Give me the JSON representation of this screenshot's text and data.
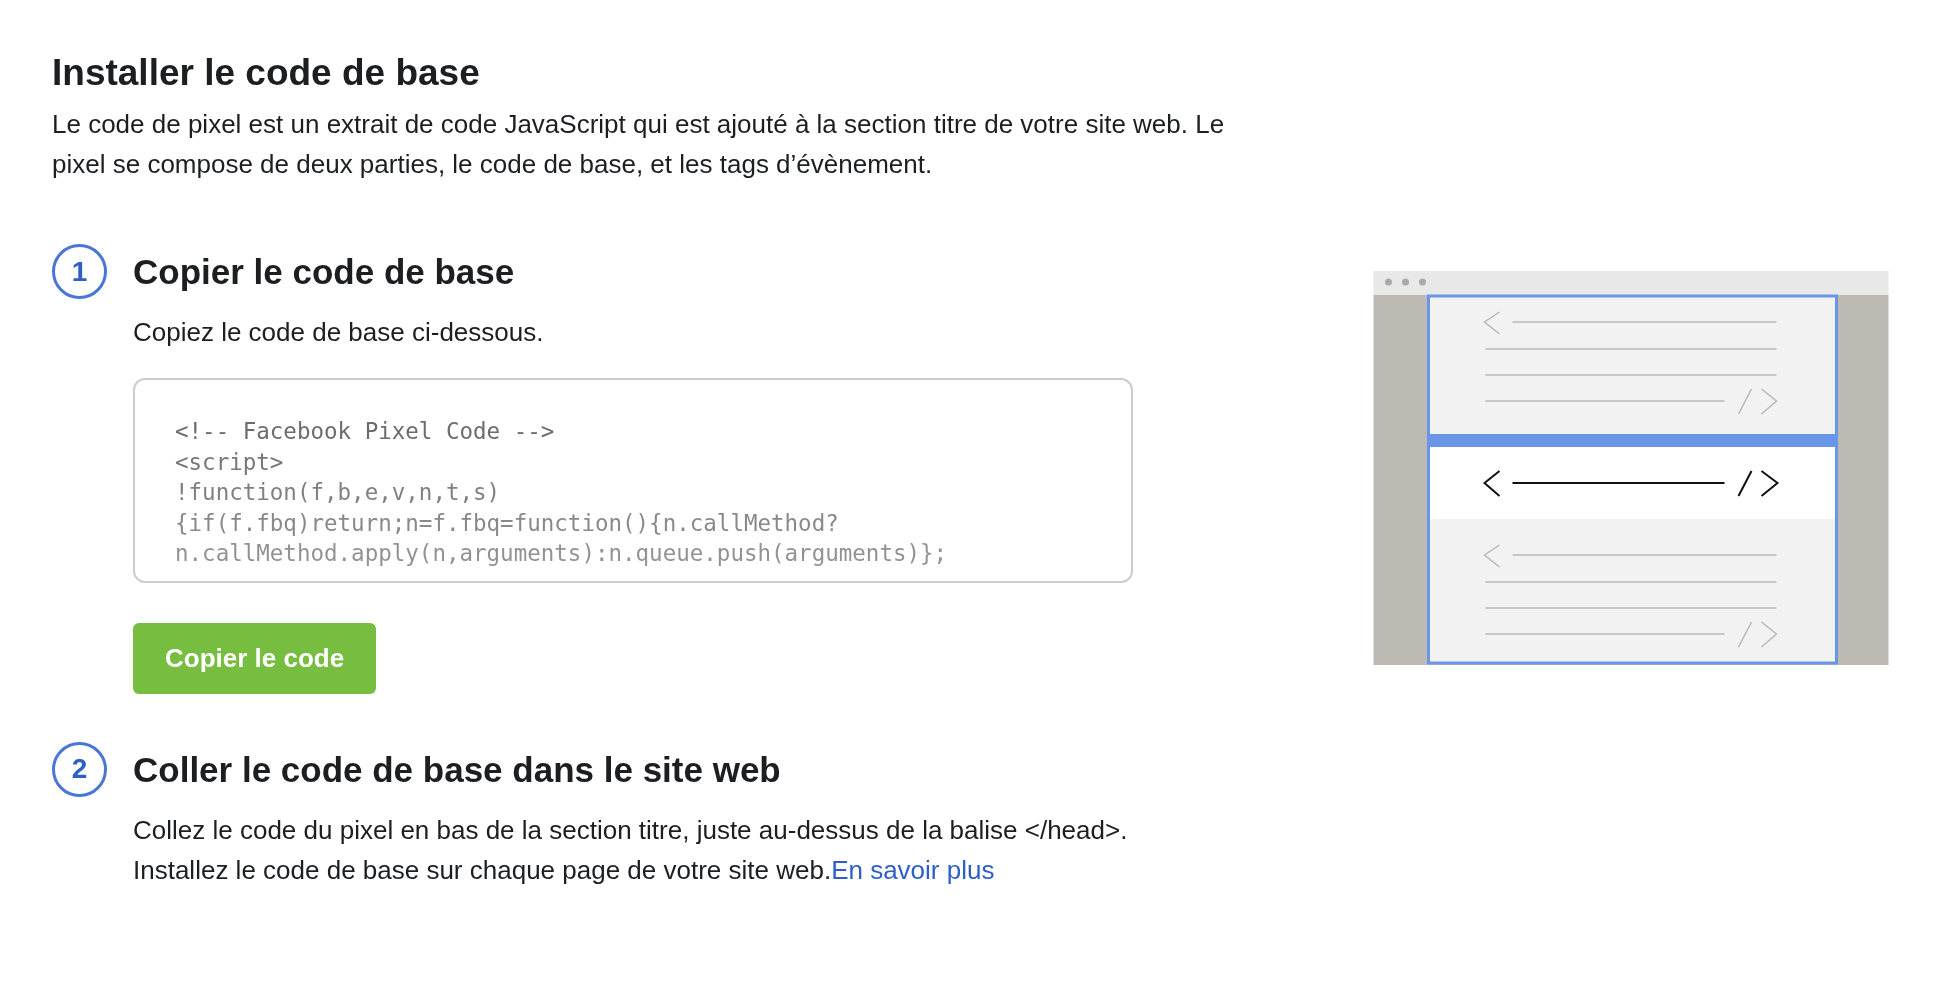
{
  "title": "Installer le code de base",
  "intro": "Le code de pixel est un extrait de code JavaScript qui est ajouté à la section titre de votre site web. Le pixel se compose de deux parties, le code de base, et les tags d’évènement.",
  "steps": [
    {
      "number": "1",
      "title": "Copier le code de base",
      "description": "Copiez le code de base ci-dessous.",
      "code": [
        "<!-- Facebook Pixel Code -->",
        "<script>",
        "!function(f,b,e,v,n,t,s)",
        "{if(f.fbq)return;n=f.fbq=function(){n.callMethod?",
        "n.callMethod.apply(n,arguments):n.queue.push(arguments)};"
      ],
      "button": "Copier le code"
    },
    {
      "number": "2",
      "title": "Coller le code de base dans le site web",
      "description": "Collez le code du pixel en bas de la section titre, juste au-dessus de la balise </head>. Installez le code de base sur chaque page de votre site web.",
      "link": "En savoir plus"
    }
  ]
}
